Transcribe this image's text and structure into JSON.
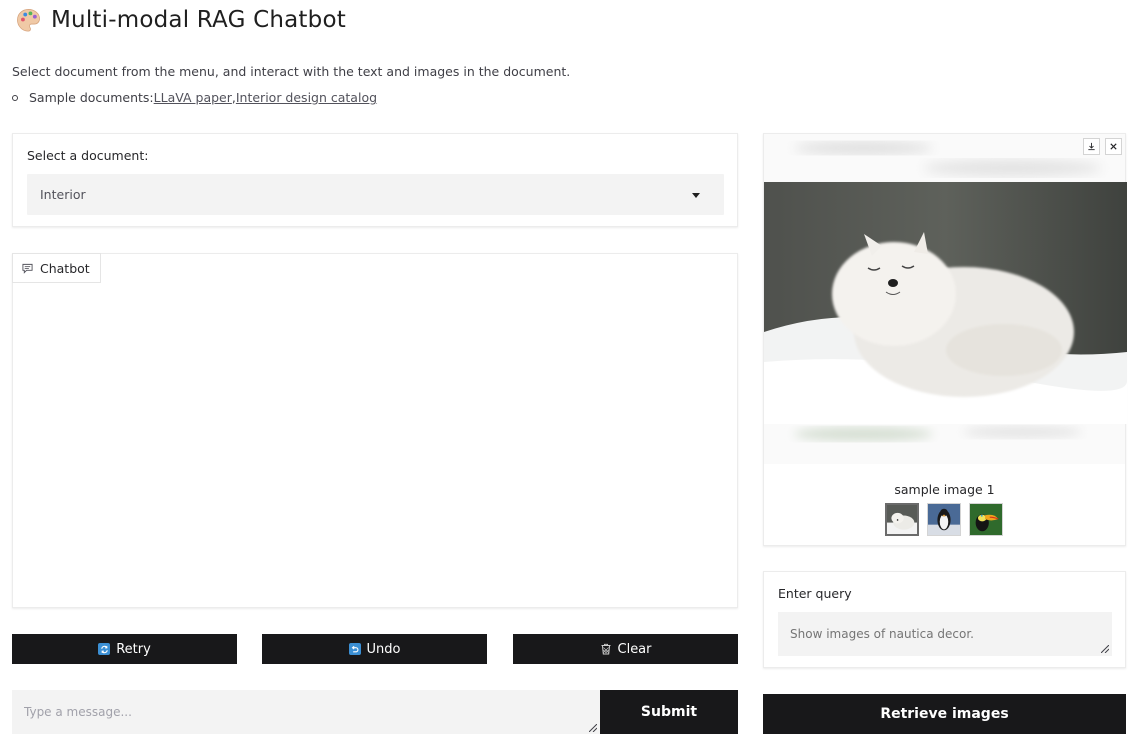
{
  "header": {
    "title": "Multi-modal RAG Chatbot",
    "logo_icon": "palette-icon",
    "description": "Select document from the menu, and interact with the text and images in the document.",
    "samples_prefix": "Sample documents: ",
    "samples": [
      {
        "label": "LLaVA paper"
      },
      {
        "label": "Interior design catalog"
      }
    ],
    "samples_separator": ", "
  },
  "document_selector": {
    "label": "Select a document:",
    "selected": "Interior"
  },
  "chatbot": {
    "label": "Chatbot",
    "icon": "chat-bubble-icon"
  },
  "actions": {
    "retry": {
      "label": "Retry",
      "icon": "retry-icon"
    },
    "undo": {
      "label": "Undo",
      "icon": "undo-icon"
    },
    "clear": {
      "label": "Clear",
      "icon": "trash-icon"
    }
  },
  "message_box": {
    "placeholder": "Type a message...",
    "value": "",
    "submit_label": "Submit"
  },
  "gallery": {
    "caption": "sample image 1",
    "download_icon": "download-icon",
    "close_icon": "close-icon",
    "thumbnails": [
      {
        "name": "arctic-fox",
        "selected": true
      },
      {
        "name": "penguin",
        "selected": false
      },
      {
        "name": "toucan",
        "selected": false
      }
    ]
  },
  "query": {
    "label": "Enter query",
    "placeholder": "Show images of nautica decor."
  },
  "retrieve": {
    "label": "Retrieve images"
  },
  "colors": {
    "dark_button": "#18181a",
    "input_bg": "#f3f3f3",
    "accent_icon": "#3b8fd4"
  }
}
